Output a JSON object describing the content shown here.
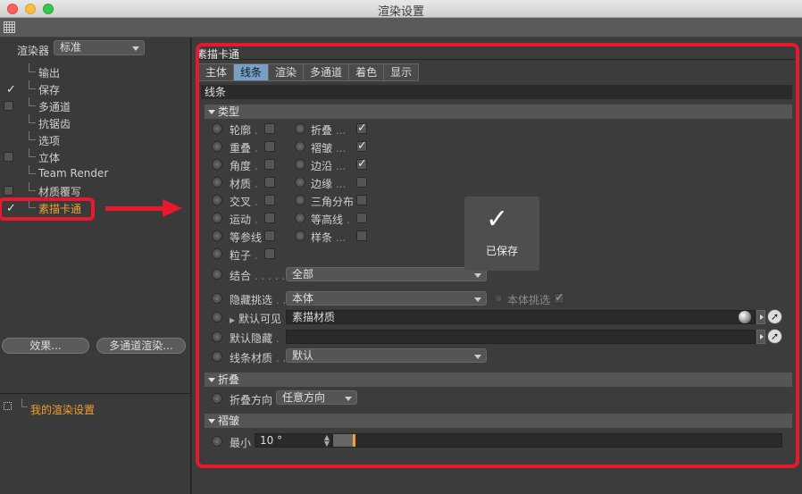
{
  "window": {
    "title": "渲染设置"
  },
  "sidebar": {
    "renderer_label": "渲染器",
    "renderer_value": "标准",
    "items": [
      {
        "label": "输出",
        "checkbox": false,
        "checked": false,
        "selected": false
      },
      {
        "label": "保存",
        "checkbox": true,
        "checked": true,
        "selected": false
      },
      {
        "label": "多通道",
        "checkbox": true,
        "checked": false,
        "selected": false
      },
      {
        "label": "抗锯齿",
        "checkbox": false,
        "checked": false,
        "selected": false
      },
      {
        "label": "选项",
        "checkbox": false,
        "checked": false,
        "selected": false
      },
      {
        "label": "立体",
        "checkbox": true,
        "checked": false,
        "selected": false
      },
      {
        "label": "Team Render",
        "checkbox": false,
        "checked": false,
        "selected": false
      },
      {
        "label": "材质覆写",
        "checkbox": true,
        "checked": false,
        "selected": false
      },
      {
        "label": "素描卡通",
        "checkbox": true,
        "checked": true,
        "selected": true
      }
    ],
    "effects_button": "效果...",
    "multipass_button": "多通道渲染...",
    "preset_label": "我的渲染设置"
  },
  "panel": {
    "title": "素描卡通",
    "tabs": [
      "主体",
      "线条",
      "渲染",
      "多通道",
      "着色",
      "显示"
    ],
    "active_tab": 1,
    "section_lines": "线条",
    "group_type": "类型",
    "type_options_left": [
      {
        "label": "轮廓",
        "dots": ".",
        "checked": false
      },
      {
        "label": "重叠",
        "dots": ".",
        "checked": false
      },
      {
        "label": "角度",
        "dots": ".",
        "checked": false
      },
      {
        "label": "材质",
        "dots": ".",
        "checked": false
      },
      {
        "label": "交叉",
        "dots": ".",
        "checked": false
      },
      {
        "label": "运动",
        "dots": ".",
        "checked": false
      },
      {
        "label": "等参线",
        "dots": "",
        "checked": false
      },
      {
        "label": "粒子",
        "dots": ".",
        "checked": false
      }
    ],
    "type_options_right": [
      {
        "label": "折叠",
        "dots": "...",
        "checked": true
      },
      {
        "label": "褶皱",
        "dots": "...",
        "checked": true
      },
      {
        "label": "边沿",
        "dots": "...",
        "checked": true
      },
      {
        "label": "边缘",
        "dots": "...",
        "checked": false
      },
      {
        "label": "三角分布",
        "dots": "",
        "checked": false
      },
      {
        "label": "等高线",
        "dots": ".",
        "checked": false
      },
      {
        "label": "样条",
        "dots": "...",
        "checked": false
      }
    ],
    "combine_label": "结合",
    "combine_dots": ". . . . .",
    "combine_value": "全部",
    "hidden_pick_label": "隐藏挑选",
    "hidden_pick_dots": ". .",
    "hidden_pick_value": "本体",
    "body_pick_label": "本体挑选",
    "default_visible_label": "默认可见",
    "default_visible_value": "素描材质",
    "default_hidden_label": "默认隐藏",
    "default_hidden_dots": ".",
    "default_hidden_value": "",
    "line_material_label": "线条材质",
    "line_material_dots": ". .",
    "line_material_value": "默认",
    "group_fold": "折叠",
    "fold_direction_label": "折叠方向",
    "fold_direction_value": "任意方向",
    "group_crease": "褶皱",
    "min_label": "最小",
    "min_value": "10 °",
    "min_slider_fraction": 0.044
  },
  "toast": {
    "text": "已保存"
  },
  "colors": {
    "highlight": "#e8192c",
    "selected_text": "#f0a030",
    "active_tab": "#7b9ec4"
  }
}
